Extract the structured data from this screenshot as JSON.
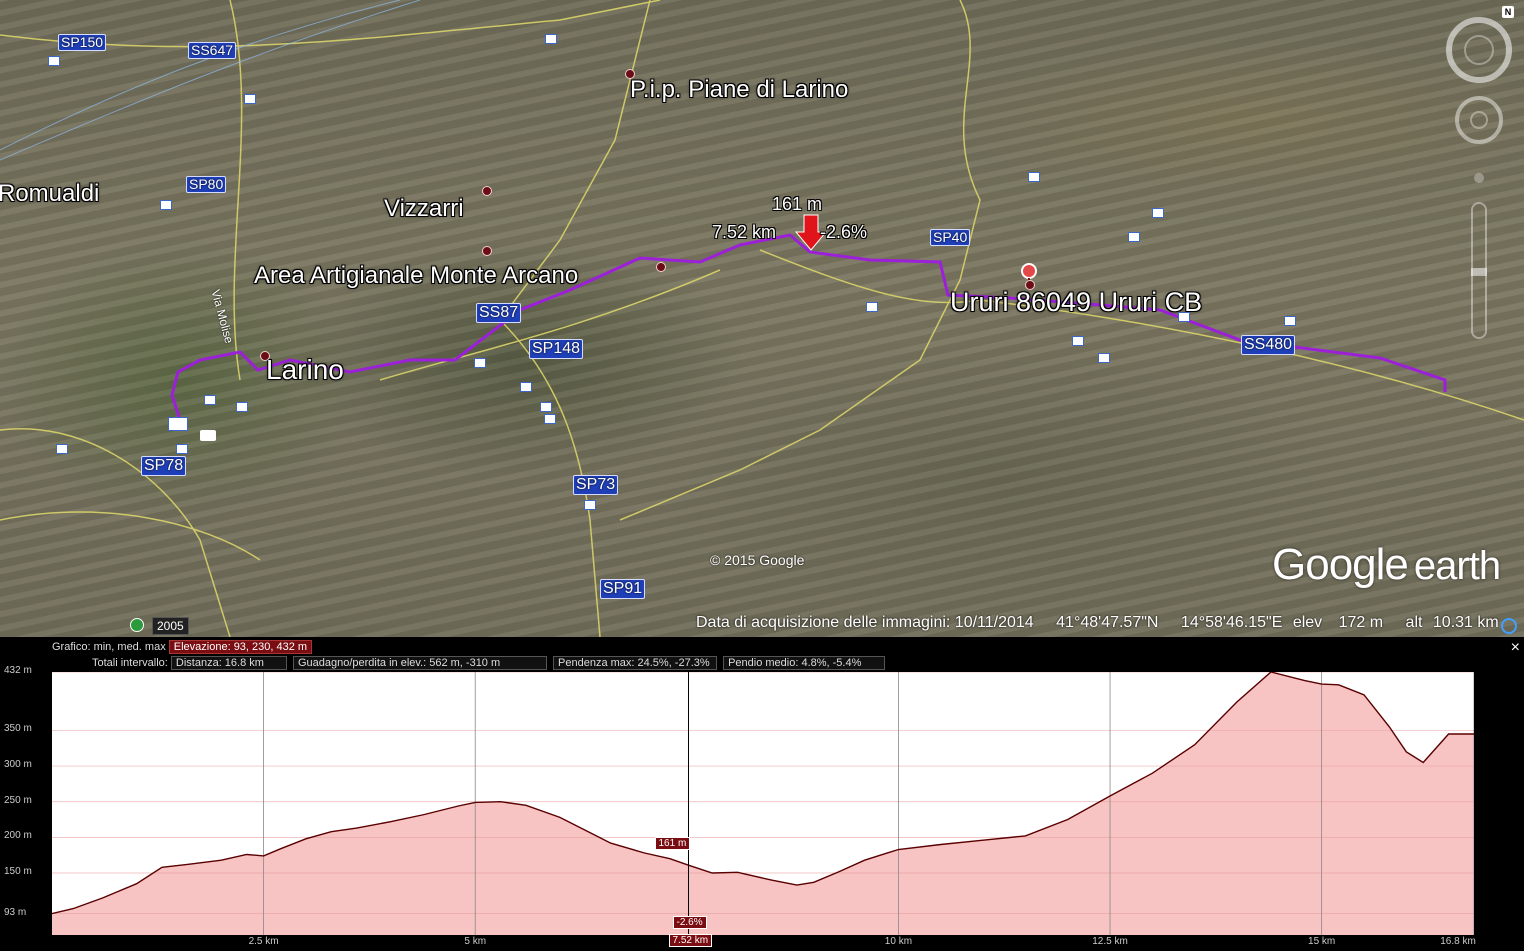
{
  "map": {
    "places": {
      "pip": "P.i.p. Piane di Larino",
      "romualdi": "Romualdi",
      "vizzarri": "Vizzarri",
      "area_artigianale": "Area Artigianale Monte Arcano",
      "larino": "Larino",
      "ururi": "Ururi 86049 Ururi CB"
    },
    "roads": {
      "sp150": "SP150",
      "ss647": "SS647",
      "sp80": "SP80",
      "ss87": "SS87",
      "sp148": "SP148",
      "sp40": "SP40",
      "ss480": "SS480",
      "sp78": "SP78",
      "sp73": "SP73",
      "sp91": "SP91",
      "via_molise": "Via Molise"
    },
    "cursor_annotation": {
      "elevation": "161 m",
      "distance": "7.52 km",
      "slope": "-2.6%"
    },
    "copyright": "© 2015 Google",
    "brand": {
      "google": "Google",
      "earth": "earth"
    },
    "year": "2005",
    "status": {
      "acquisition": "Data di acquisizione delle immagini: 10/11/2014",
      "lat": "41°48'47.57\"N",
      "lon": "14°58'46.15\"E",
      "elev_label": "elev",
      "elev_value": "172 m",
      "alt_label": "alt",
      "alt_value": "10.31 km"
    },
    "compass_letter": "N",
    "route_color": "#9b20d8"
  },
  "profile": {
    "row1_label": "Grafico: min, med. max",
    "row1_value": "Elevazione: 93, 230, 432 m",
    "row2_label": "Totali intervallo:",
    "distance": "Distanza: 16.8 km",
    "gain_loss": "Guadagno/perdita in elev.: 562 m, -310 m",
    "slope_max": "Pendenza max: 24.5%, -27.3%",
    "slope_avg": "Pendio medio: 4.8%, -5.4%",
    "close_icon": "×",
    "cursor": {
      "elevation": "161 m",
      "slope": "-2.6%",
      "distance": "7.52 km",
      "distance_km": 7.52
    },
    "fill_color": "#f7c3c3",
    "line_color": "#5a0000"
  },
  "chart_data": {
    "type": "area",
    "title": "",
    "xlabel": "",
    "ylabel": "",
    "xlim": [
      0,
      16.8
    ],
    "ylim": [
      63,
      432
    ],
    "x_ticks": [
      {
        "v": 2.5,
        "label": "2.5 km"
      },
      {
        "v": 5,
        "label": "5 km"
      },
      {
        "v": 10,
        "label": "10 km"
      },
      {
        "v": 12.5,
        "label": "12.5 km"
      },
      {
        "v": 15,
        "label": "15 km"
      },
      {
        "v": 16.8,
        "label": "16.8 km"
      }
    ],
    "y_ticks": [
      {
        "v": 93,
        "label": "93 m"
      },
      {
        "v": 150,
        "label": "150 m"
      },
      {
        "v": 200,
        "label": "200 m"
      },
      {
        "v": 250,
        "label": "250 m"
      },
      {
        "v": 300,
        "label": "300 m"
      },
      {
        "v": 350,
        "label": "350 m"
      },
      {
        "v": 432,
        "label": "432 m"
      }
    ],
    "x": [
      0,
      0.25,
      0.6,
      1.0,
      1.3,
      1.6,
      2.0,
      2.3,
      2.5,
      2.7,
      3.0,
      3.3,
      3.6,
      4.0,
      4.4,
      4.8,
      5.0,
      5.3,
      5.6,
      6.0,
      6.3,
      6.6,
      7.0,
      7.3,
      7.52,
      7.8,
      8.1,
      8.5,
      8.8,
      9.0,
      9.3,
      9.6,
      10.0,
      10.5,
      11.0,
      11.5,
      12.0,
      12.5,
      13.0,
      13.5,
      14.0,
      14.4,
      14.8,
      15.0,
      15.2,
      15.5,
      15.8,
      16.0,
      16.2,
      16.5,
      16.8
    ],
    "y": [
      93,
      100,
      115,
      135,
      158,
      162,
      168,
      176,
      174,
      184,
      198,
      208,
      213,
      222,
      232,
      244,
      249,
      250,
      245,
      228,
      210,
      192,
      178,
      170,
      161,
      150,
      151,
      140,
      133,
      137,
      152,
      168,
      183,
      190,
      196,
      202,
      225,
      258,
      290,
      330,
      390,
      432,
      420,
      415,
      414,
      400,
      355,
      320,
      305,
      345,
      345
    ],
    "grid": true
  }
}
